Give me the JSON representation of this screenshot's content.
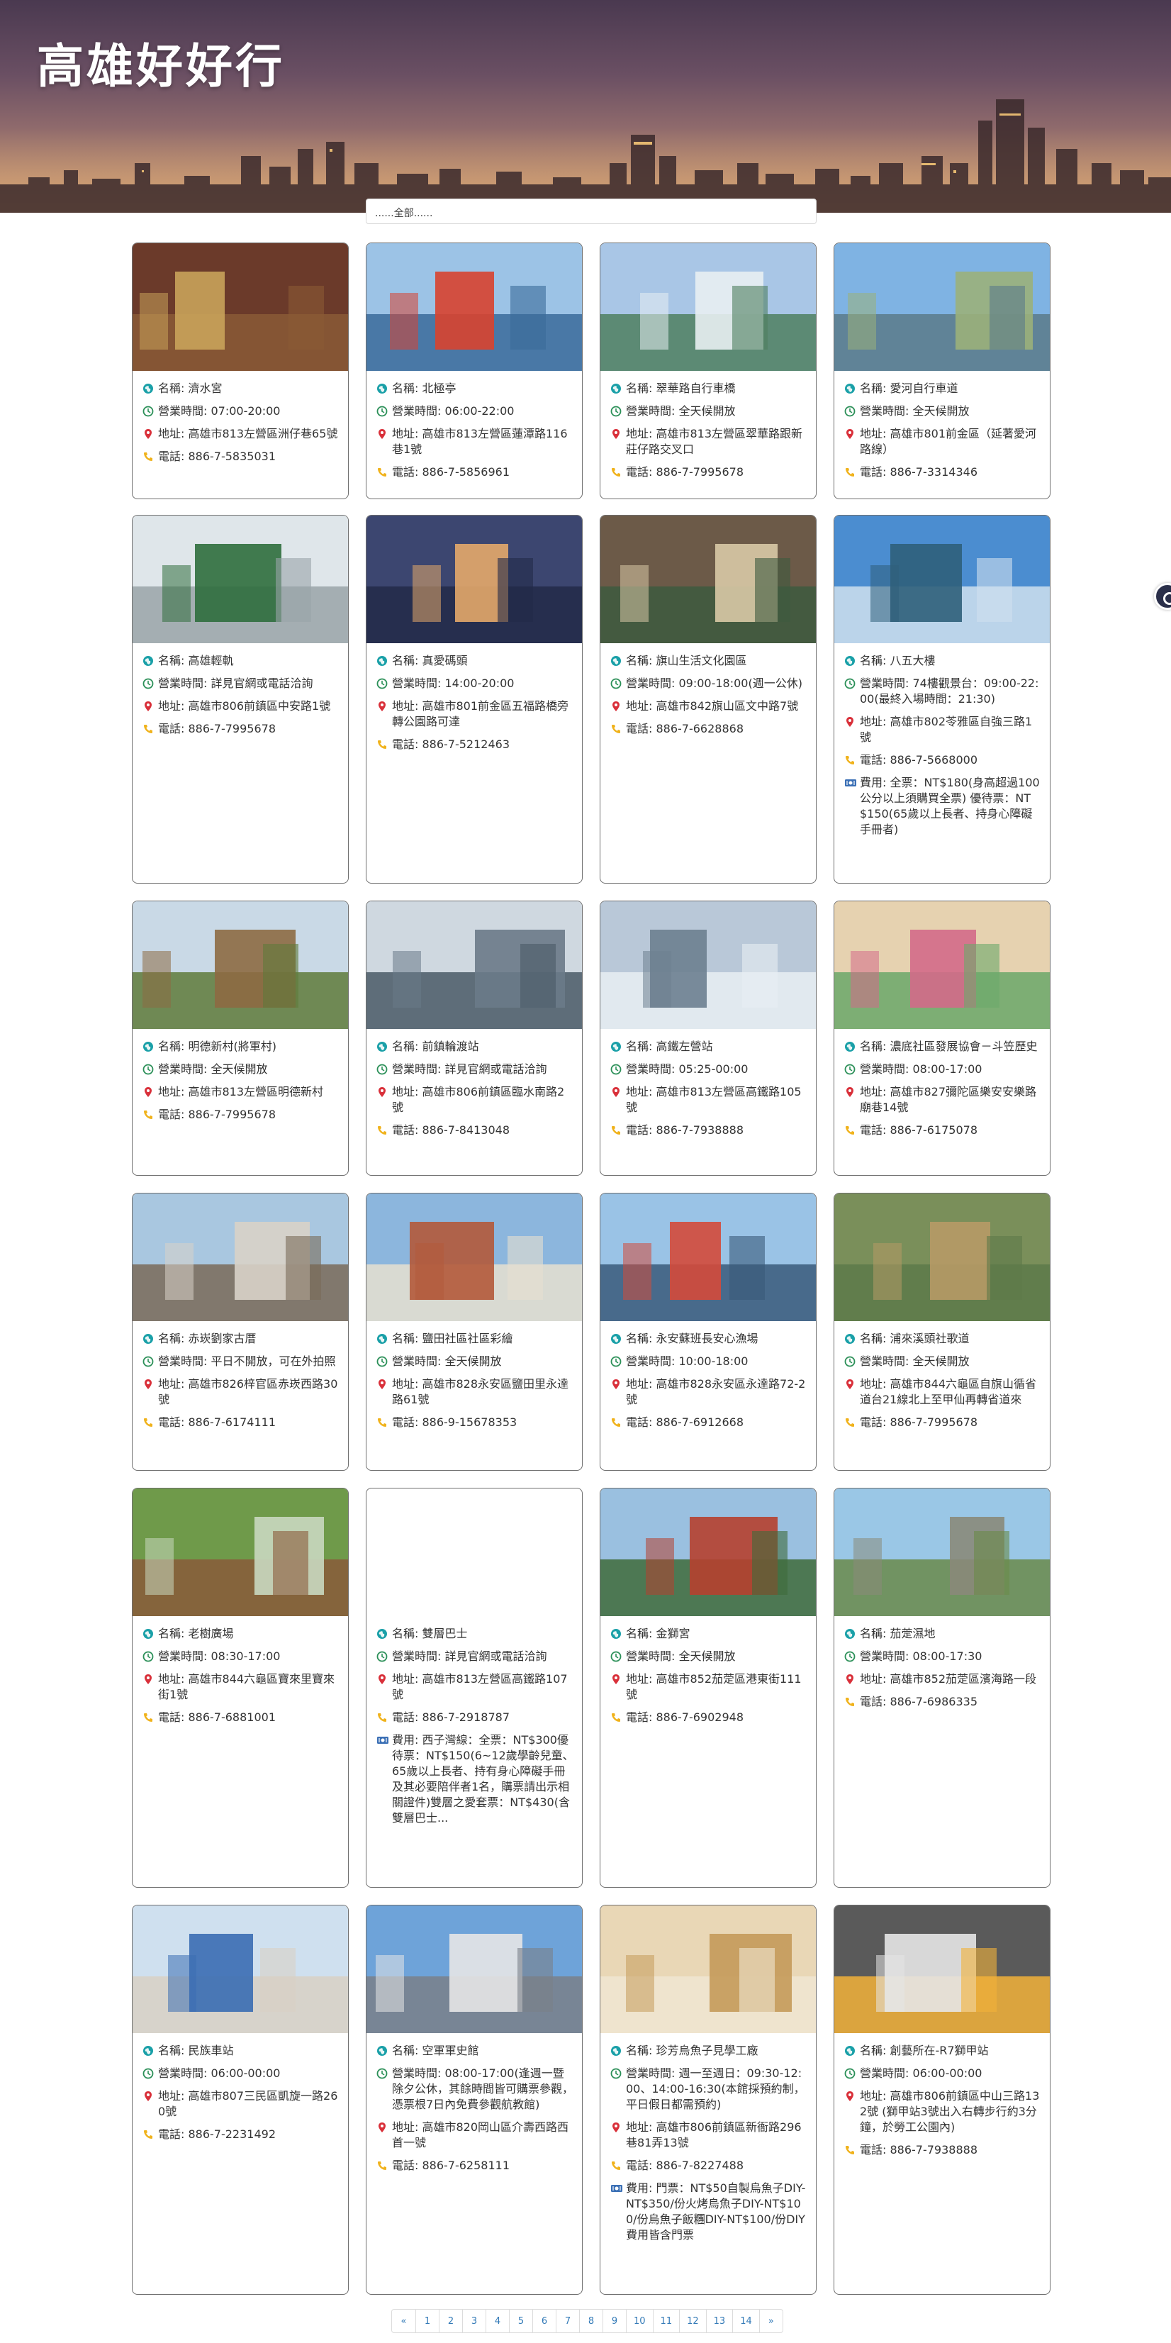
{
  "site": {
    "title": "高雄好好行"
  },
  "filter": {
    "selected": "......全部......"
  },
  "icons": {
    "name": "globe-icon",
    "hours": "clock-icon",
    "address": "map-pin-icon",
    "phone": "phone-icon",
    "fee": "ticket-icon"
  },
  "colors": {
    "globe": "#1aa0a8",
    "clock": "#2a8f57",
    "pin": "#d9303a",
    "phone": "#f0b21b",
    "ticket": "#3a6fb5"
  },
  "cards": [
    {
      "name": "名稱: 濟水宮",
      "hours": "營業時間: 07:00-20:00",
      "address": "地址: 高雄市813左營區洲仔巷65號",
      "phone": "電話: 886-7-5835031",
      "fee": ""
    },
    {
      "name": "名稱: 北極亭",
      "hours": "營業時間: 06:00-22:00",
      "address": "地址: 高雄市813左營區蓮潭路116巷1號",
      "phone": "電話: 886-7-5856961",
      "fee": ""
    },
    {
      "name": "名稱: 翠華路自行車橋",
      "hours": "營業時間: 全天候開放",
      "address": "地址: 高雄市813左營區翠華路跟新莊仔路交叉口",
      "phone": "電話: 886-7-7995678",
      "fee": ""
    },
    {
      "name": "名稱: 愛河自行車道",
      "hours": "營業時間: 全天候開放",
      "address": "地址: 高雄市801前金區（延著愛河路線）",
      "phone": "電話: 886-7-3314346",
      "fee": ""
    },
    {
      "name": "名稱: 高雄輕軌",
      "hours": "營業時間: 詳見官網或電話洽詢",
      "address": "地址: 高雄市806前鎮區中安路1號",
      "phone": "電話: 886-7-7995678",
      "fee": ""
    },
    {
      "name": "名稱: 真愛碼頭",
      "hours": "營業時間: 14:00-20:00",
      "address": "地址: 高雄市801前金區五福路橋旁轉公園路可達",
      "phone": "電話: 886-7-5212463",
      "fee": ""
    },
    {
      "name": "名稱: 旗山生活文化園區",
      "hours": "營業時間: 09:00-18:00(週一公休)",
      "address": "地址: 高雄市842旗山區文中路7號",
      "phone": "電話: 886-7-6628868",
      "fee": ""
    },
    {
      "name": "名稱: 八五大樓",
      "hours": "營業時間: 74樓觀景台：09:00-22:00(最終入場時間：21:30)",
      "address": "地址: 高雄市802苓雅區自強三路1號",
      "phone": "電話: 886-7-5668000",
      "fee": "費用: 全票：NT$180(身高超過100公分以上須購買全票) 優待票：NT$150(65歲以上長者、持身心障礙手冊者)"
    },
    {
      "name": "名稱: 明德新村(將軍村)",
      "hours": "營業時間: 全天候開放",
      "address": "地址: 高雄市813左營區明德新村",
      "phone": "電話: 886-7-7995678",
      "fee": ""
    },
    {
      "name": "名稱: 前鎮輪渡站",
      "hours": "營業時間: 詳見官網或電話洽詢",
      "address": "地址: 高雄市806前鎮區臨水南路2號",
      "phone": "電話: 886-7-8413048",
      "fee": ""
    },
    {
      "name": "名稱: 高鐵左營站",
      "hours": "營業時間: 05:25-00:00",
      "address": "地址: 高雄市813左營區高鐵路105號",
      "phone": "電話: 886-7-7938888",
      "fee": ""
    },
    {
      "name": "名稱: 濃底社區發展協會－斗笠歷史",
      "hours": "營業時間: 08:00-17:00",
      "address": "地址: 高雄市827彌陀區樂安安樂路廟巷14號",
      "phone": "電話: 886-7-6175078",
      "fee": ""
    },
    {
      "name": "名稱: 赤崁劉家古厝",
      "hours": "營業時間: 平日不開放，可在外拍照",
      "address": "地址: 高雄市826梓官區赤崁西路30號",
      "phone": "電話: 886-7-6174111",
      "fee": ""
    },
    {
      "name": "名稱: 鹽田社區社區彩繪",
      "hours": "營業時間: 全天候開放",
      "address": "地址: 高雄市828永安區鹽田里永達路61號",
      "phone": "電話: 886-9-15678353",
      "fee": ""
    },
    {
      "name": "名稱: 永安蘇班長安心漁場",
      "hours": "營業時間: 10:00-18:00",
      "address": "地址: 高雄市828永安區永達路72-2號",
      "phone": "電話: 886-7-6912668",
      "fee": ""
    },
    {
      "name": "名稱: 浦來溪頭社歌道",
      "hours": "營業時間: 全天候開放",
      "address": "地址: 高雄市844六龜區自旗山循省道台21線北上至甲仙再轉省道來",
      "phone": "電話: 886-7-7995678",
      "fee": ""
    },
    {
      "name": "名稱: 老樹廣場",
      "hours": "營業時間: 08:30-17:00",
      "address": "地址: 高雄市844六龜區寶來里寶來街1號",
      "phone": "電話: 886-7-6881001",
      "fee": ""
    },
    {
      "name": "名稱: 雙層巴士",
      "hours": "營業時間: 詳見官網或電話洽詢",
      "address": "地址: 高雄市813左營區高鐵路107號",
      "phone": "電話: 886-7-2918787",
      "fee": "費用: 西子灣線：全票：NT$300優待票：NT$150(6~12歲學齡兒童、65歲以上長者、持有身心障礙手冊及其必要陪伴者1名，購票請出示相關證件)雙層之愛套票：NT$430(含雙層巴士..."
    },
    {
      "name": "名稱: 金獅宮",
      "hours": "營業時間: 全天候開放",
      "address": "地址: 高雄市852茄萣區港東街111號",
      "phone": "電話: 886-7-6902948",
      "fee": ""
    },
    {
      "name": "名稱: 茄萣濕地",
      "hours": "營業時間: 08:00-17:30",
      "address": "地址: 高雄市852茄萣區濱海路一段",
      "phone": "電話: 886-7-6986335",
      "fee": ""
    },
    {
      "name": "名稱: 民族車站",
      "hours": "營業時間: 06:00-00:00",
      "address": "地址: 高雄市807三民區凱旋一路260號",
      "phone": "電話: 886-7-2231492",
      "fee": ""
    },
    {
      "name": "名稱: 空軍軍史館",
      "hours": "營業時間: 08:00-17:00(逢週一暨除夕公休，其餘時間皆可購票參觀，憑票根7日內免費參觀航教館)",
      "address": "地址: 高雄市820岡山區介壽西路西首一號",
      "phone": "電話: 886-7-6258111",
      "fee": ""
    },
    {
      "name": "名稱: 珍芳烏魚子見學工廠",
      "hours": "營業時間: 週一至週日：09:30-12:00、14:00-16:30(本館採預約制，平日假日都需預約)",
      "address": "地址: 高雄市806前鎮區新衙路296巷81弄13號",
      "phone": "電話: 886-7-8227488",
      "fee": "費用: 門票：NT$50自製烏魚子DIY-NT$350/份火烤烏魚子DIY-NT$100/份烏魚子飯糰DIY-NT$100/份DIY費用皆含門票"
    },
    {
      "name": "名稱: 創藝所在-R7獅甲站",
      "hours": "營業時間: 06:00-00:00",
      "address": "地址: 高雄市806前鎮區中山三路132號 (獅甲站3號出入右轉步行約3分鐘，於勞工公園內)",
      "phone": "電話: 886-7-7938888",
      "fee": ""
    }
  ],
  "pagination": {
    "items": [
      "«",
      "1",
      "2",
      "3",
      "4",
      "5",
      "6",
      "7",
      "8",
      "9",
      "10",
      "11",
      "12",
      "13",
      "14",
      "»"
    ]
  }
}
